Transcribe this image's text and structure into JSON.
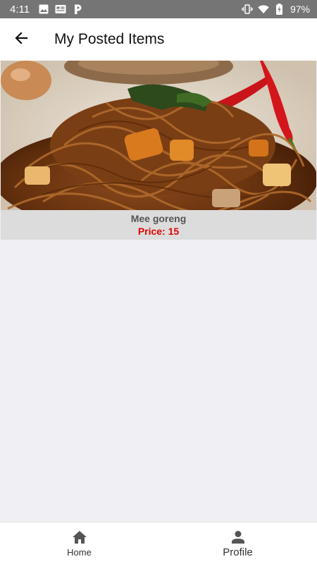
{
  "status_bar": {
    "time": "4:11",
    "battery": "97%",
    "left_icons": [
      "image-icon",
      "news-icon",
      "parking-icon"
    ],
    "right_icons": [
      "vibrate-icon",
      "wifi-icon",
      "battery-charging-icon"
    ]
  },
  "app_bar": {
    "title": "My Posted Items",
    "back_icon": "arrow-back-icon"
  },
  "items": [
    {
      "name": "Mee goreng",
      "price": "Price: 15"
    }
  ],
  "bottom_nav": {
    "home_label": "Home",
    "profile_label": "Profile",
    "home_icon": "home-icon",
    "profile_icon": "person-icon"
  },
  "colors": {
    "status_bar": "#757575",
    "background": "#efeff4",
    "card": "#dcdcdc",
    "price": "#e30000"
  }
}
